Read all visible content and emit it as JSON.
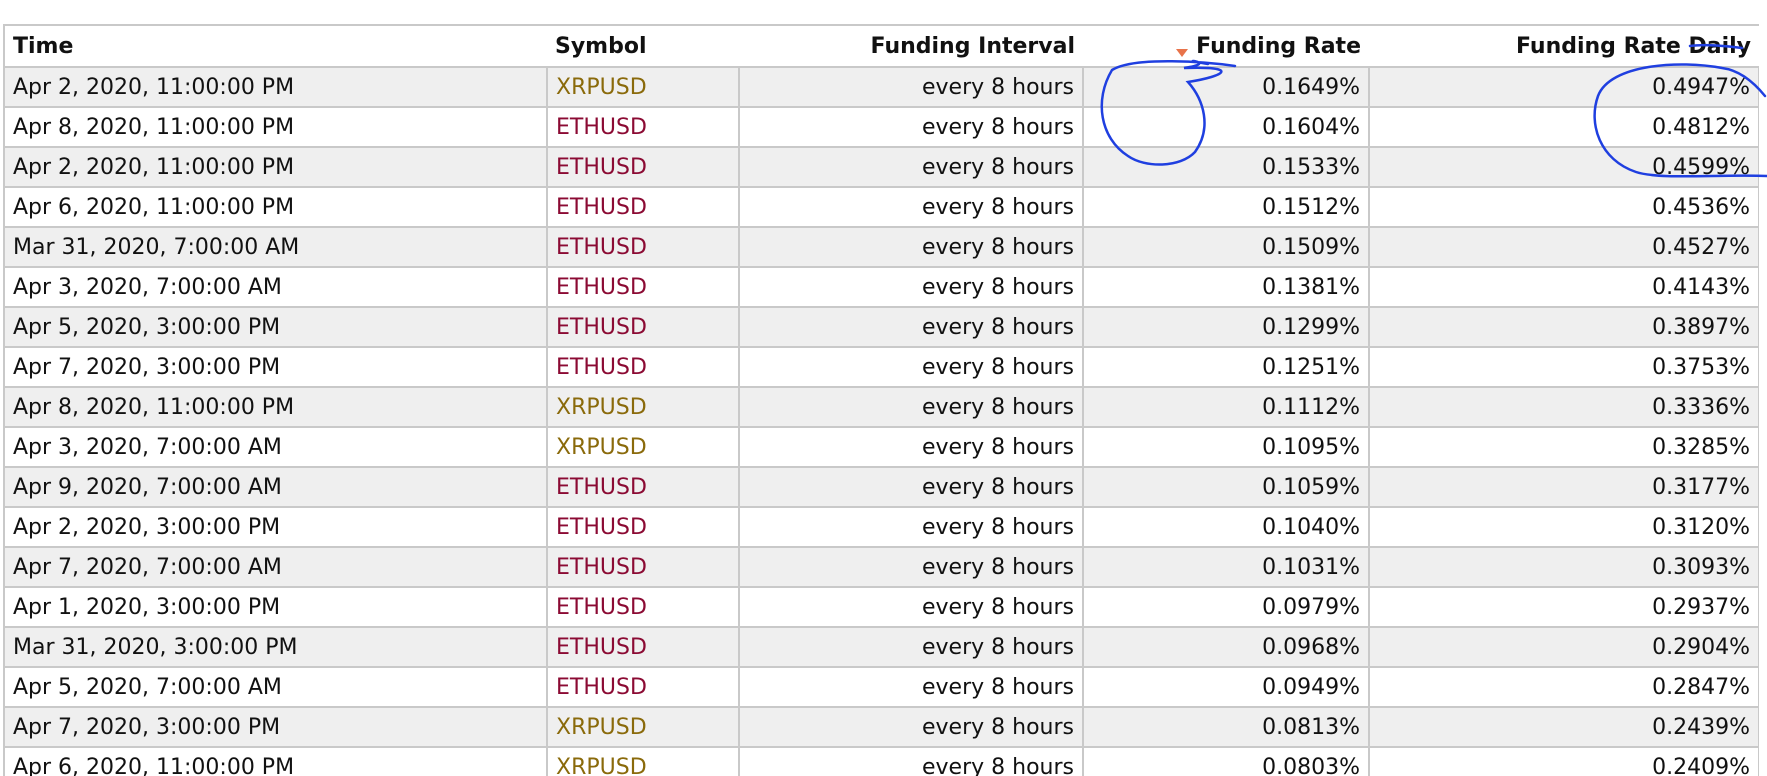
{
  "table": {
    "columns": {
      "time": "Time",
      "symbol": "Symbol",
      "interval": "Funding Interval",
      "rate": "Funding Rate",
      "daily": "Funding Rate Daily"
    },
    "sort": {
      "column": "Funding Rate",
      "direction": "descending",
      "icon": "sort-down-icon",
      "color": "#e8734a"
    },
    "rows": [
      {
        "time": "Apr 2, 2020, 11:00:00 PM",
        "symbol": "XRPUSD",
        "interval": "every 8 hours",
        "rate": "0.1649%",
        "daily": "0.4947%"
      },
      {
        "time": "Apr 8, 2020, 11:00:00 PM",
        "symbol": "ETHUSD",
        "interval": "every 8 hours",
        "rate": "0.1604%",
        "daily": "0.4812%"
      },
      {
        "time": "Apr 2, 2020, 11:00:00 PM",
        "symbol": "ETHUSD",
        "interval": "every 8 hours",
        "rate": "0.1533%",
        "daily": "0.4599%"
      },
      {
        "time": "Apr 6, 2020, 11:00:00 PM",
        "symbol": "ETHUSD",
        "interval": "every 8 hours",
        "rate": "0.1512%",
        "daily": "0.4536%"
      },
      {
        "time": "Mar 31, 2020, 7:00:00 AM",
        "symbol": "ETHUSD",
        "interval": "every 8 hours",
        "rate": "0.1509%",
        "daily": "0.4527%"
      },
      {
        "time": "Apr 3, 2020, 7:00:00 AM",
        "symbol": "ETHUSD",
        "interval": "every 8 hours",
        "rate": "0.1381%",
        "daily": "0.4143%"
      },
      {
        "time": "Apr 5, 2020, 3:00:00 PM",
        "symbol": "ETHUSD",
        "interval": "every 8 hours",
        "rate": "0.1299%",
        "daily": "0.3897%"
      },
      {
        "time": "Apr 7, 2020, 3:00:00 PM",
        "symbol": "ETHUSD",
        "interval": "every 8 hours",
        "rate": "0.1251%",
        "daily": "0.3753%"
      },
      {
        "time": "Apr 8, 2020, 11:00:00 PM",
        "symbol": "XRPUSD",
        "interval": "every 8 hours",
        "rate": "0.1112%",
        "daily": "0.3336%"
      },
      {
        "time": "Apr 3, 2020, 7:00:00 AM",
        "symbol": "XRPUSD",
        "interval": "every 8 hours",
        "rate": "0.1095%",
        "daily": "0.3285%"
      },
      {
        "time": "Apr 9, 2020, 7:00:00 AM",
        "symbol": "ETHUSD",
        "interval": "every 8 hours",
        "rate": "0.1059%",
        "daily": "0.3177%"
      },
      {
        "time": "Apr 2, 2020, 3:00:00 PM",
        "symbol": "ETHUSD",
        "interval": "every 8 hours",
        "rate": "0.1040%",
        "daily": "0.3120%"
      },
      {
        "time": "Apr 7, 2020, 7:00:00 AM",
        "symbol": "ETHUSD",
        "interval": "every 8 hours",
        "rate": "0.1031%",
        "daily": "0.3093%"
      },
      {
        "time": "Apr 1, 2020, 3:00:00 PM",
        "symbol": "ETHUSD",
        "interval": "every 8 hours",
        "rate": "0.0979%",
        "daily": "0.2937%"
      },
      {
        "time": "Mar 31, 2020, 3:00:00 PM",
        "symbol": "ETHUSD",
        "interval": "every 8 hours",
        "rate": "0.0968%",
        "daily": "0.2904%"
      },
      {
        "time": "Apr 5, 2020, 7:00:00 AM",
        "symbol": "ETHUSD",
        "interval": "every 8 hours",
        "rate": "0.0949%",
        "daily": "0.2847%"
      },
      {
        "time": "Apr 7, 2020, 3:00:00 PM",
        "symbol": "XRPUSD",
        "interval": "every 8 hours",
        "rate": "0.0813%",
        "daily": "0.2439%"
      },
      {
        "time": "Apr 6, 2020, 11:00:00 PM",
        "symbol": "XRPUSD",
        "interval": "every 8 hours",
        "rate": "0.0803%",
        "daily": "0.2409%"
      }
    ]
  },
  "symbol_colors": {
    "XRPUSD": "#8a6a0b",
    "ETHUSD": "#8b0a33"
  },
  "annotation_color": "#1f3fe0"
}
